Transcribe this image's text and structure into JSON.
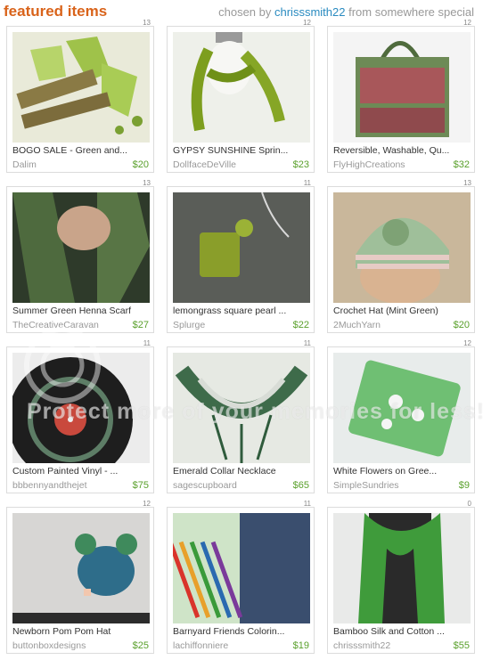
{
  "header": {
    "title": "featured items",
    "chosen_prefix": "chosen by",
    "curator": "chrisssmith22",
    "chosen_from": "from",
    "source": "somewhere special"
  },
  "watermark": "Protect more of your memories for less!",
  "items": [
    {
      "title": "BOGO SALE - Green and...",
      "shop": "Dalim",
      "price": "$20",
      "count": "13"
    },
    {
      "title": "GYPSY SUNSHINE Sprin...",
      "shop": "DollfaceDeVille",
      "price": "$23",
      "count": "12"
    },
    {
      "title": "Reversible, Washable, Qu...",
      "shop": "FlyHighCreations",
      "price": "$32",
      "count": "12"
    },
    {
      "title": "Summer Green Henna Scarf",
      "shop": "TheCreativeCaravan",
      "price": "$27",
      "count": "13"
    },
    {
      "title": "lemongrass square pearl ...",
      "shop": "Splurge",
      "price": "$22",
      "count": "11"
    },
    {
      "title": "Crochet Hat (Mint Green)",
      "shop": "2MuchYarn",
      "price": "$20",
      "count": "13"
    },
    {
      "title": "Custom Painted Vinyl - ...",
      "shop": "bbbennyandthejet",
      "price": "$75",
      "count": "11"
    },
    {
      "title": "Emerald Collar Necklace",
      "shop": "sagescupboard",
      "price": "$65",
      "count": "11"
    },
    {
      "title": "White Flowers on Gree...",
      "shop": "SimpleSundries",
      "price": "$9",
      "count": "12"
    },
    {
      "title": "Newborn Pom Pom Hat",
      "shop": "buttonboxdesigns",
      "price": "$25",
      "count": "12"
    },
    {
      "title": "Barnyard Friends Colorin...",
      "shop": "lachiffonniere",
      "price": "$19",
      "count": "11"
    },
    {
      "title": "Bamboo Silk and Cotton ...",
      "shop": "chrisssmith22",
      "price": "$55",
      "count": "0"
    }
  ]
}
